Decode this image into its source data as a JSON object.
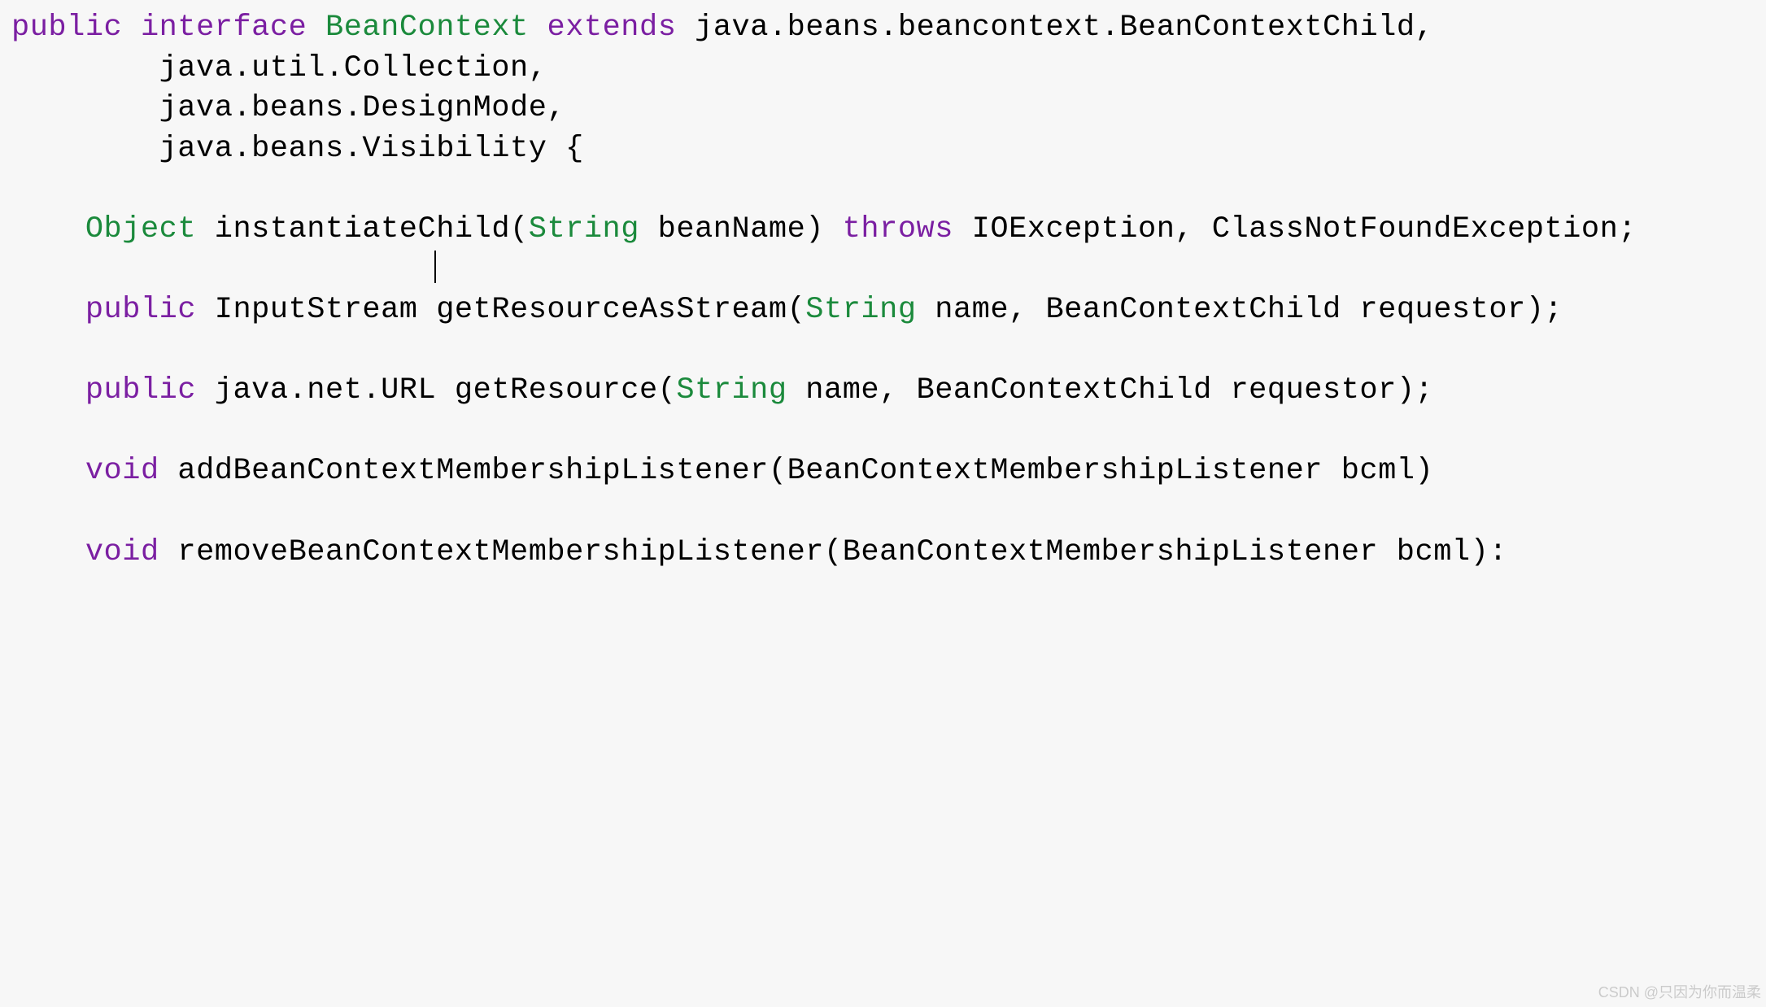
{
  "code": {
    "tokens": [
      [
        [
          "public",
          "kw"
        ],
        [
          " ",
          "txt"
        ],
        [
          "interface",
          "kw"
        ],
        [
          " ",
          "txt"
        ],
        [
          "BeanContext",
          "typ"
        ],
        [
          " ",
          "txt"
        ],
        [
          "extends",
          "kw"
        ],
        [
          " java.beans.beancontext.BeanContextChild,",
          "txt"
        ]
      ],
      [
        [
          "        java.util.Collection,",
          "txt"
        ]
      ],
      [
        [
          "        java.beans.DesignMode,",
          "txt"
        ]
      ],
      [
        [
          "        java.beans.Visibility {",
          "txt"
        ]
      ],
      [
        [
          "",
          "txt"
        ]
      ],
      [
        [
          "    ",
          "txt"
        ],
        [
          "Object",
          "typ"
        ],
        [
          " instantiateChild(",
          "txt"
        ],
        [
          "String",
          "typ"
        ],
        [
          " beanName) ",
          "txt"
        ],
        [
          "throws",
          "kw"
        ],
        [
          " IOException, ClassNotFoundException;",
          "txt"
        ]
      ],
      [
        [
          "",
          "cursor-line"
        ]
      ],
      [
        [
          "    ",
          "txt"
        ],
        [
          "public",
          "kw"
        ],
        [
          " InputStream getResourceAsStream(",
          "txt"
        ],
        [
          "String",
          "typ"
        ],
        [
          " name, BeanContextChild requestor);",
          "txt"
        ]
      ],
      [
        [
          "",
          "txt"
        ]
      ],
      [
        [
          "    ",
          "txt"
        ],
        [
          "public",
          "kw"
        ],
        [
          " java.net.URL getResource(",
          "txt"
        ],
        [
          "String",
          "typ"
        ],
        [
          " name, BeanContextChild requestor);",
          "txt"
        ]
      ],
      [
        [
          "",
          "txt"
        ]
      ],
      [
        [
          "    ",
          "txt"
        ],
        [
          "void",
          "kw"
        ],
        [
          " addBeanContextMembershipListener(BeanContextMembershipListener bcml)",
          "txt"
        ]
      ],
      [
        [
          "",
          "txt"
        ]
      ],
      [
        [
          "    ",
          "txt"
        ],
        [
          "void",
          "kw"
        ],
        [
          " removeBeanContextMembershipListener(BeanContextMembershipListener bcml):",
          "txt"
        ]
      ]
    ],
    "cursor_after_line_index": 5,
    "cursor_indent": "                       "
  },
  "watermark": "CSDN @只因为你而温柔"
}
